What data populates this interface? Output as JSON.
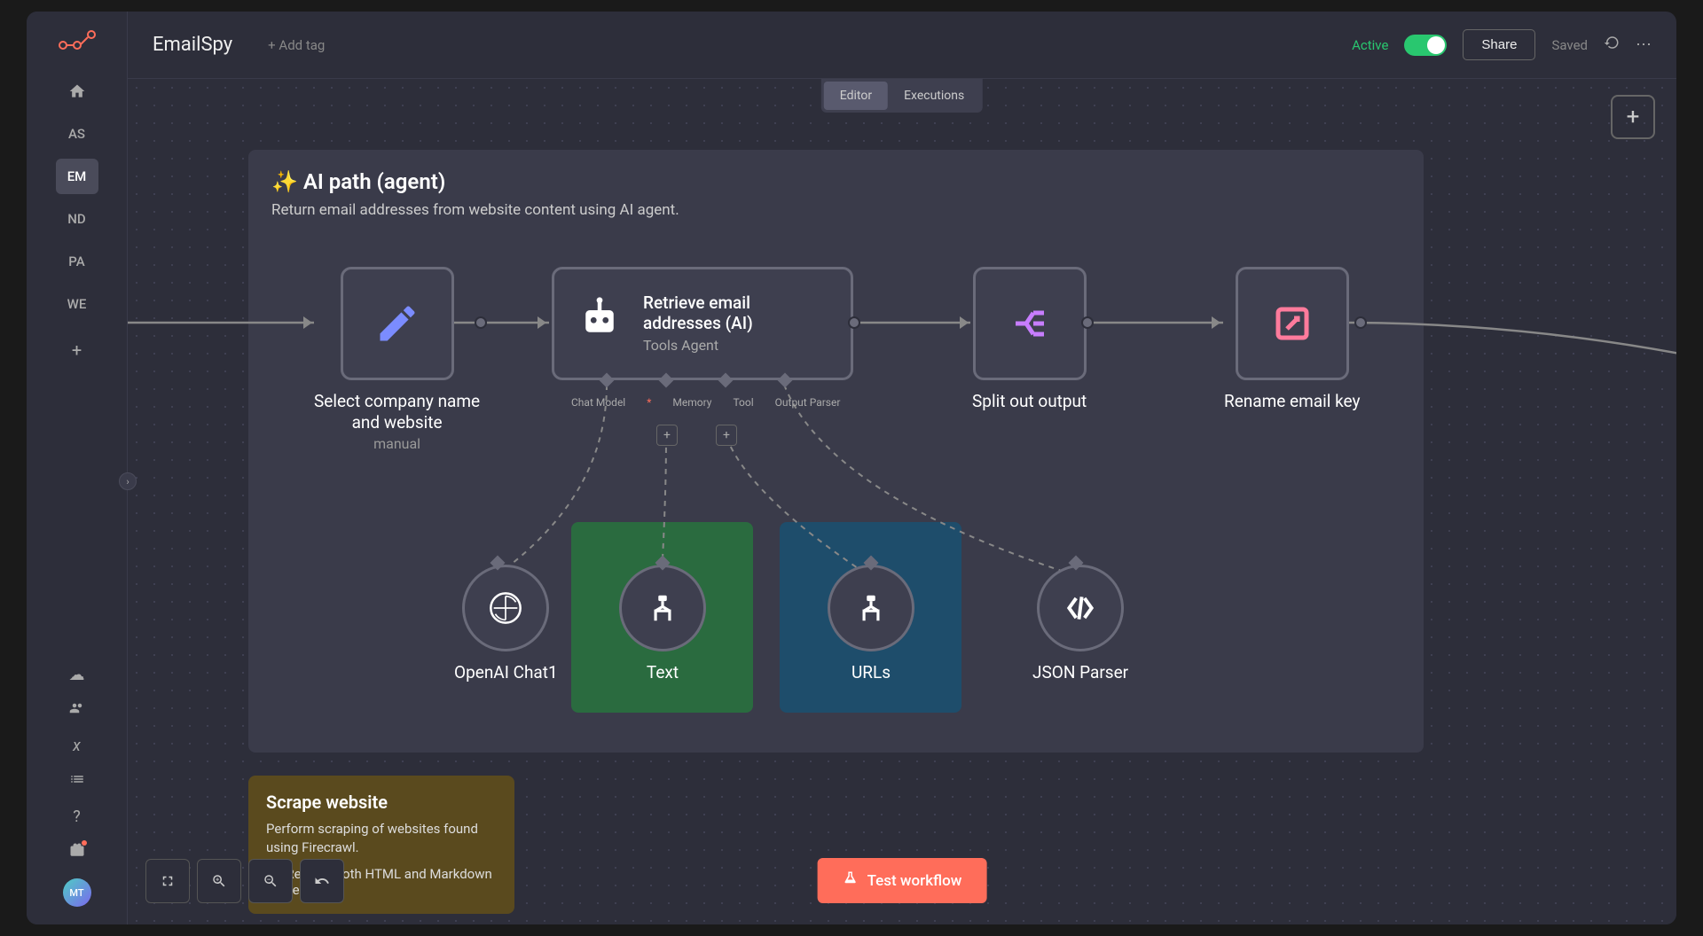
{
  "workflow": {
    "title": "EmailSpy",
    "addTag": "+ Add tag"
  },
  "topbar": {
    "activeLabel": "Active",
    "share": "Share",
    "saved": "Saved"
  },
  "tabs": {
    "editor": "Editor",
    "executions": "Executions"
  },
  "sidebar": {
    "items": [
      "AS",
      "EM",
      "ND",
      "PA",
      "WE"
    ],
    "avatar": "MT"
  },
  "sticky": {
    "ai": {
      "title": "✨ AI path (agent)",
      "desc": "Return email addresses from website content using AI agent."
    },
    "scrape": {
      "title": "Scrape website",
      "text": "Perform scraping of websites found using Firecrawl.",
      "warn": "⚠️ Returns both HTML and Markdown content."
    }
  },
  "nodes": {
    "select": {
      "label1": "Select company name",
      "label2": "and website",
      "sub": "manual"
    },
    "agent": {
      "title": "Retrieve email addresses (AI)",
      "sub": "Tools Agent"
    },
    "split": {
      "label": "Split out output"
    },
    "rename": {
      "label": "Rename email key"
    },
    "openai": {
      "label": "OpenAI Chat1"
    },
    "text": {
      "label": "Text"
    },
    "urls": {
      "label": "URLs"
    },
    "parser": {
      "label": "JSON Parser"
    }
  },
  "agentPorts": {
    "chatModel": "Chat Model",
    "memory": "Memory",
    "tool": "Tool",
    "outputParser": "Output Parser"
  },
  "testBtn": "Test workflow",
  "required": "*"
}
